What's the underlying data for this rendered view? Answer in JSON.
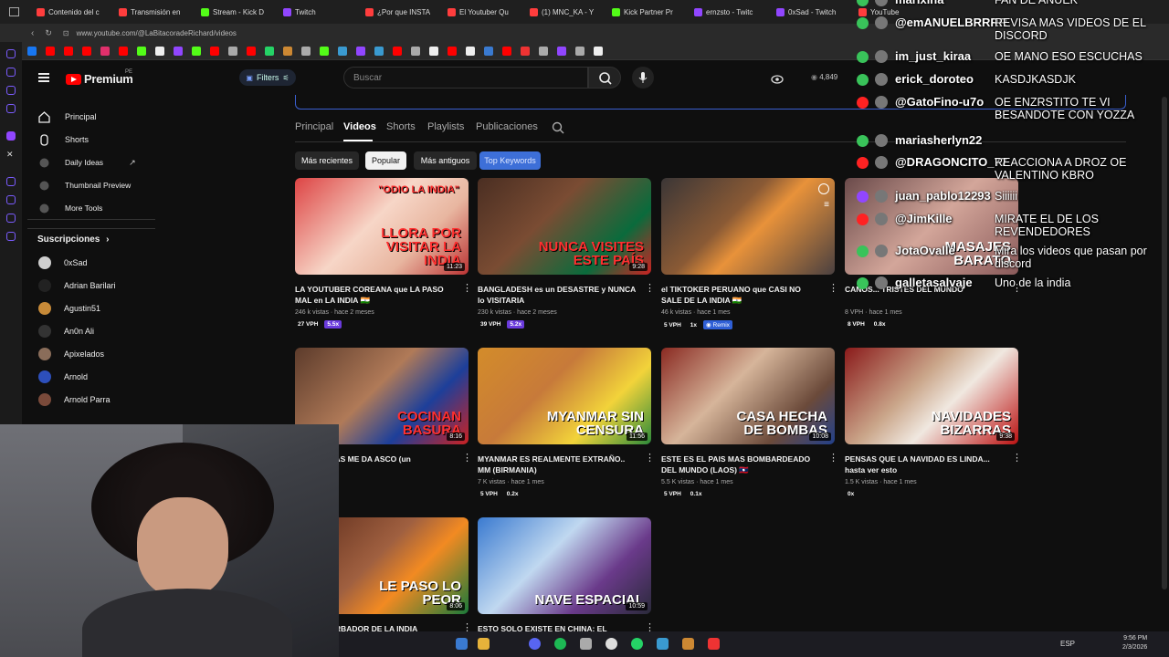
{
  "browser": {
    "tabs": [
      "Contenido del c",
      "Transmisión en",
      "Stream - Kick D",
      "Twitch",
      "¿Por que INSTA",
      "El Youtuber Qu",
      "(1) MNC_KA - Y",
      "Kick Partner Pr",
      "ernzsto - Twitc",
      "0xSad - Twitch",
      "YouTube"
    ],
    "tab_colors": [
      "#ff3d3d",
      "#ff3d3d",
      "#53fc18",
      "#9146ff",
      "#ff3d3d",
      "#ff3d3d",
      "#ff3d3d",
      "#53fc18",
      "#9146ff",
      "#9146ff",
      "#ff3d3d"
    ],
    "url": "www.youtube.com/@LaBitacoradeRichard/videos"
  },
  "header": {
    "logo_text": "Premium",
    "logo_region": "PE",
    "filters_label": "Filters",
    "search_placeholder": "Buscar",
    "views_count": "4,849"
  },
  "sidebar": {
    "items": [
      {
        "label": "Principal",
        "icon": "home-icon"
      },
      {
        "label": "Shorts",
        "icon": "shorts-icon"
      },
      {
        "label": "Daily Ideas",
        "icon": "idea-icon"
      },
      {
        "label": "Thumbnail Preview",
        "icon": "preview-icon"
      },
      {
        "label": "More Tools",
        "icon": "tools-icon"
      }
    ],
    "subs_title": "Suscripciones",
    "subs": [
      {
        "label": "0xSad",
        "color": "#cfcfcf"
      },
      {
        "label": "Adrian Barilari",
        "color": "#222"
      },
      {
        "label": "Agustin51",
        "color": "#c78a38"
      },
      {
        "label": "An0n Ali",
        "color": "#333"
      },
      {
        "label": "Apixelados",
        "color": "#8a6d5a"
      },
      {
        "label": "Arnold",
        "color": "#2d4fbb"
      },
      {
        "label": "Arnold Parra",
        "color": "#7a4a3a"
      }
    ]
  },
  "channel": {
    "tabs": [
      "Principal",
      "Videos",
      "Shorts",
      "Playlists",
      "Publicaciones"
    ],
    "active_tab": "Videos",
    "chips": [
      "Más recientes",
      "Popular",
      "Más antiguos",
      "Top Keywords"
    ],
    "selected_chip": "Popular"
  },
  "videos": [
    {
      "title": "LA YOUTUBER COREANA que LA PASO MAL en LA INDIA 🇮🇳",
      "meta": "246 k vistas · hace 2 meses",
      "vph": "27 VPH",
      "mult": "5.5x",
      "duration": "11:23",
      "thumb_text": "LLORA POR VISITAR LA INDIA",
      "thumb_top": "\"ODIO LA INDIA\"",
      "bg": "linear-gradient(135deg,#d44 0%,#f7d6c7 45%,#e8b6a0 70%,#b33 100%)"
    },
    {
      "title": "BANGLADESH es un DESASTRE y NUNCA lo VISITARIA",
      "meta": "230 k vistas · hace 2 meses",
      "vph": "39 VPH",
      "mult": "5.2x",
      "duration": "9:28",
      "thumb_text": "NUNCA VISITES ESTE PAÍS",
      "thumb_top": "",
      "bg": "linear-gradient(135deg,#4a2e22 0%,#7a4c33 40%,#0a6b3c 75%,#c22 100%)"
    },
    {
      "title": "el TIKTOKER PERUANO que CASI NO SALE DE LA INDIA 🇮🇳",
      "meta": "46 k vistas · hace 1 mes",
      "vph": "5 VPH",
      "mult": "1x",
      "duration": "",
      "thumb_text": "",
      "thumb_top": "",
      "bg": "linear-gradient(135deg,#3b3636 0%,#8a5a35 40%,#e8923a 55%,#4a4040 100%)"
    },
    {
      "title": "CAÑOS... TRISTES DEL MUNDO",
      "meta": "8 VPH · hace 1 mes",
      "vph": "8 VPH",
      "mult": "0.8x",
      "duration": "",
      "thumb_text": "MASAJES BARATO",
      "thumb_top": "",
      "bg": "linear-gradient(135deg,#6a4a4a 0%,#d3a69a 50%,#8a5a5a 100%)"
    },
    {
      "title": "DE FILIPINAS ME DA ASCO (un",
      "meta": "hace 2 meses",
      "vph": "",
      "mult": "",
      "duration": "8:16",
      "thumb_text": "COCINAN BASURA",
      "thumb_top": "",
      "bg": "linear-gradient(135deg,#5c3b2b 0%,#b07a58 45%,#1d3f9a 70%,#c22 100%)"
    },
    {
      "title": "MYANMAR ES REALMENTE EXTRAÑO.. MM (BIRMANIA)",
      "meta": "7 K vistas · hace 1 mes",
      "vph": "5 VPH",
      "mult": "0.2x",
      "duration": "11:56",
      "thumb_text": "MYANMAR SIN CENSURA",
      "thumb_top": "",
      "bg": "linear-gradient(135deg,#d38c2a 0%,#c77a3a 40%,#f2d33a 70%,#2c8a3a 100%)"
    },
    {
      "title": "ESTE ES EL PAIS MAS BOMBARDEADO DEL MUNDO (LAOS) 🇱🇦",
      "meta": "5.5 K vistas · hace 1 mes",
      "vph": "5 VPH",
      "mult": "0.1x",
      "duration": "10:08",
      "thumb_text": "CASA HECHA DE BOMBAS",
      "thumb_top": "",
      "bg": "linear-gradient(135deg,#8a2a22 0%,#d6b59a 40%,#6b4a3a 75%,#22408a 100%)"
    },
    {
      "title": "PENSAS QUE LA NAVIDAD ES LINDA... hasta ver esto",
      "meta": "1.5 K vistas · hace 1 mes",
      "vph": "",
      "mult": "0x",
      "duration": "9:38",
      "thumb_text": "NAVIDADES BIZARRAS",
      "thumb_top": "",
      "bg": "linear-gradient(135deg,#8a1a1a 0%,#caa68a 40%,#f0e8e0 60%,#b11 100%)"
    },
    {
      "title": "...S PERTURBADOR DE LA INDIA",
      "meta": "",
      "vph": "",
      "mult": "",
      "duration": "8:06",
      "thumb_text": "LE PASO LO PEOR",
      "thumb_top": "",
      "bg": "linear-gradient(135deg,#5a2a1a 0%,#a06040 45%,#f28a22 65%,#1a7a3a 100%)"
    },
    {
      "title": "ESTO SOLO EXISTE EN CHINA: EL FUTURO",
      "meta": "",
      "vph": "",
      "mult": "",
      "duration": "10:59",
      "thumb_text": "NAVE ESPACIAL",
      "thumb_top": "",
      "bg": "linear-gradient(135deg,#3a7ad0 0%,#c0d8f0 40%,#6a3a8a 70%,#2a2a3a 100%)"
    }
  ],
  "chat": [
    {
      "user": "marlxina",
      "msg": "FAN DE ANUEK",
      "badge": "#39c35a"
    },
    {
      "user": "@emANUELBRRRR",
      "msg": "REVISA MAS VIDEOS DE EL DISCORD",
      "badge": "#39c35a"
    },
    {
      "user": "im_just_kiraa",
      "msg": "OE MANO ESO ESCUCHAS",
      "badge": "#39c35a"
    },
    {
      "user": "erick_doroteo",
      "msg": "KASDJKASDJK",
      "badge": "#39c35a"
    },
    {
      "user": "@GatoFino-u7o",
      "msg": "OE ENZRSTITO TE VI BESANDOTE CON YOZZA",
      "badge": "#ff2222"
    },
    {
      "user": "mariasherlyn22",
      "msg": "",
      "badge": "#39c35a"
    },
    {
      "user": "@DRAGONCITO_77",
      "msg": "REACCIONA A DROZ OE VALENTINO KBRO",
      "badge": "#ff2222"
    },
    {
      "user": "juan_pablo12293",
      "msg": "Siiiiii",
      "badge": "#9146ff"
    },
    {
      "user": "@JimKille",
      "msg": "MIRATE EL DE LOS REVENDEDORES",
      "badge": "#ff2222"
    },
    {
      "user": "JotaOvalle",
      "msg": "Mira los videos que pasan por discord",
      "badge": "#39c35a"
    },
    {
      "user": "galletasalvaje",
      "msg": "Uno de la india",
      "badge": "#39c35a"
    }
  ],
  "taskbar": {
    "lang": "ESP",
    "time": "9:56 PM",
    "date": "2/3/2026"
  }
}
